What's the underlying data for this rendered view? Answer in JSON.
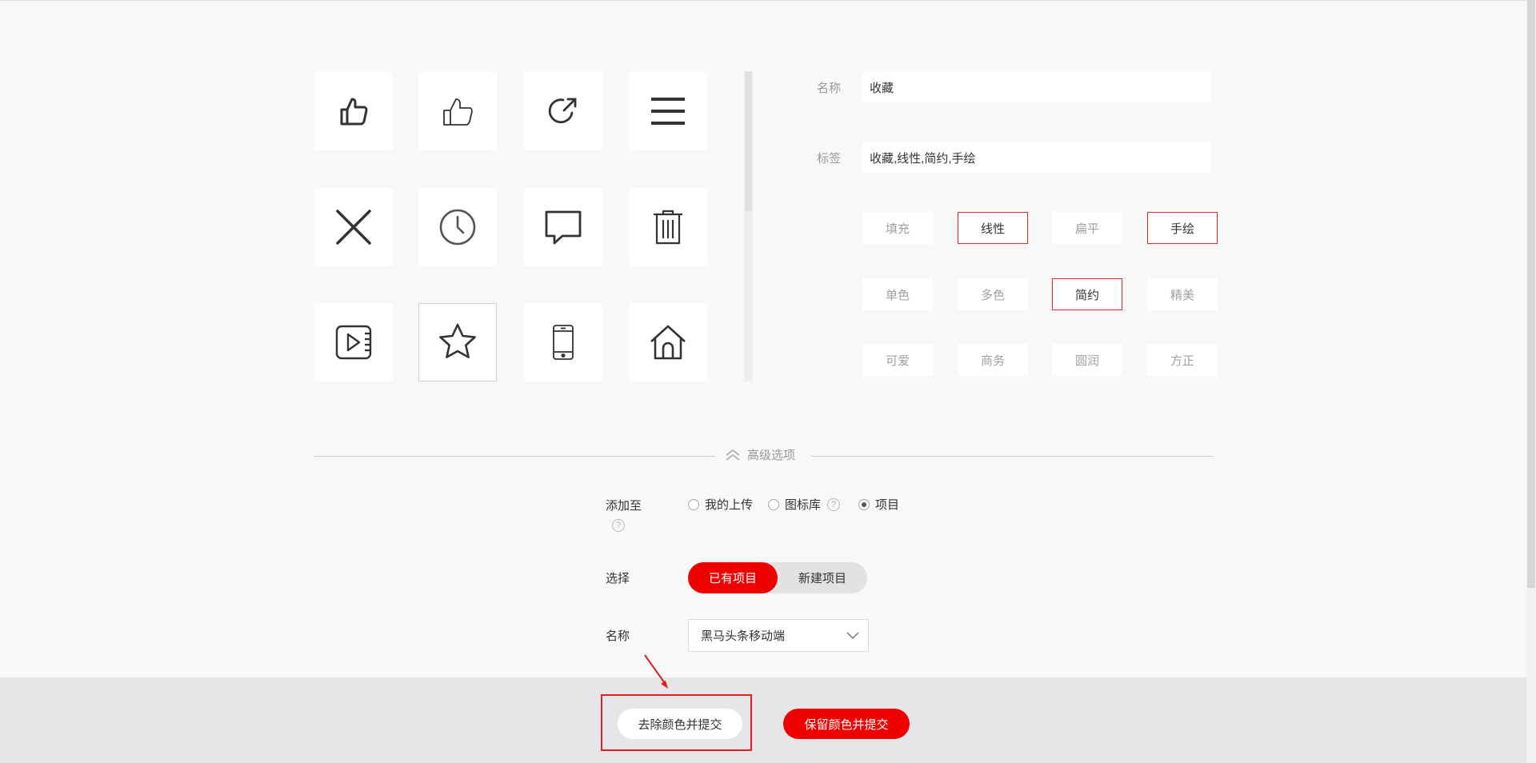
{
  "icons": [
    "thumbs-up-bold-icon",
    "thumbs-up-outline-icon",
    "share-arrow-icon",
    "menu-icon",
    "close-icon",
    "clock-icon",
    "chat-bubble-icon",
    "trash-icon",
    "video-play-icon",
    "star-icon",
    "mobile-phone-icon",
    "home-icon"
  ],
  "selected_icon": "star-icon",
  "form": {
    "name_label": "名称",
    "name_value": "收藏",
    "tags_label": "标签",
    "tags_value": "收藏,线性,简约,手绘",
    "style_tags": [
      {
        "label": "填充",
        "active": false
      },
      {
        "label": "线性",
        "active": true
      },
      {
        "label": "扁平",
        "active": false
      },
      {
        "label": "手绘",
        "active": true
      },
      {
        "label": "单色",
        "active": false
      },
      {
        "label": "多色",
        "active": false
      },
      {
        "label": "简约",
        "active": true
      },
      {
        "label": "精美",
        "active": false
      },
      {
        "label": "可爱",
        "active": false
      },
      {
        "label": "商务",
        "active": false
      },
      {
        "label": "圆润",
        "active": false
      },
      {
        "label": "方正",
        "active": false
      }
    ]
  },
  "advanced": {
    "toggle_label": "高级选项",
    "add_to_label": "添加至",
    "help_mark": "?",
    "radios": [
      {
        "label": "我的上传",
        "checked": false
      },
      {
        "label": "图标库",
        "checked": false
      },
      {
        "label": "项目",
        "checked": true
      }
    ],
    "select_label": "选择",
    "segments": [
      "已有项目",
      "新建项目"
    ],
    "active_segment": "已有项目",
    "name_label": "名称",
    "project_name": "黑马头条移动端"
  },
  "footer": {
    "remove_color_submit": "去除颜色并提交",
    "keep_color_submit": "保留颜色并提交"
  },
  "colors": {
    "accent": "#ee0000",
    "tag_border": "#e2262b",
    "highlight": "#e01e1e",
    "annotation_arrow": "#e01e1e"
  }
}
